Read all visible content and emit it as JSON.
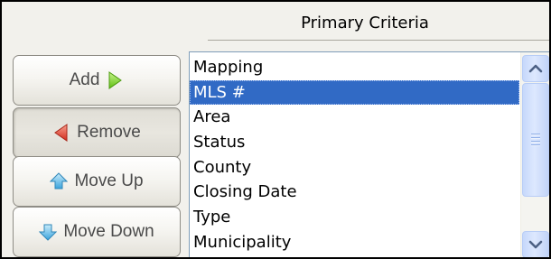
{
  "panel": {
    "title": "Primary Criteria"
  },
  "buttons": {
    "add": {
      "label": "Add",
      "icon": "arrow-right-icon",
      "color": "#7ed321"
    },
    "remove": {
      "label": "Remove",
      "icon": "arrow-left-icon",
      "color": "#e8483a"
    },
    "move_up": {
      "label": "Move Up",
      "icon": "arrow-up-icon",
      "color": "#5ab6e6"
    },
    "move_down": {
      "label": "Move Down",
      "icon": "arrow-down-icon",
      "color": "#5ab6e6"
    }
  },
  "list": {
    "items": [
      "Mapping",
      "MLS #",
      "Area",
      "Status",
      "County",
      "Closing Date",
      "Type",
      "Municipality"
    ],
    "selected_index": 1,
    "selection_color": "#316ac5"
  },
  "scrollbar": {
    "up_icon": "chevron-up-icon",
    "down_icon": "chevron-down-icon"
  }
}
